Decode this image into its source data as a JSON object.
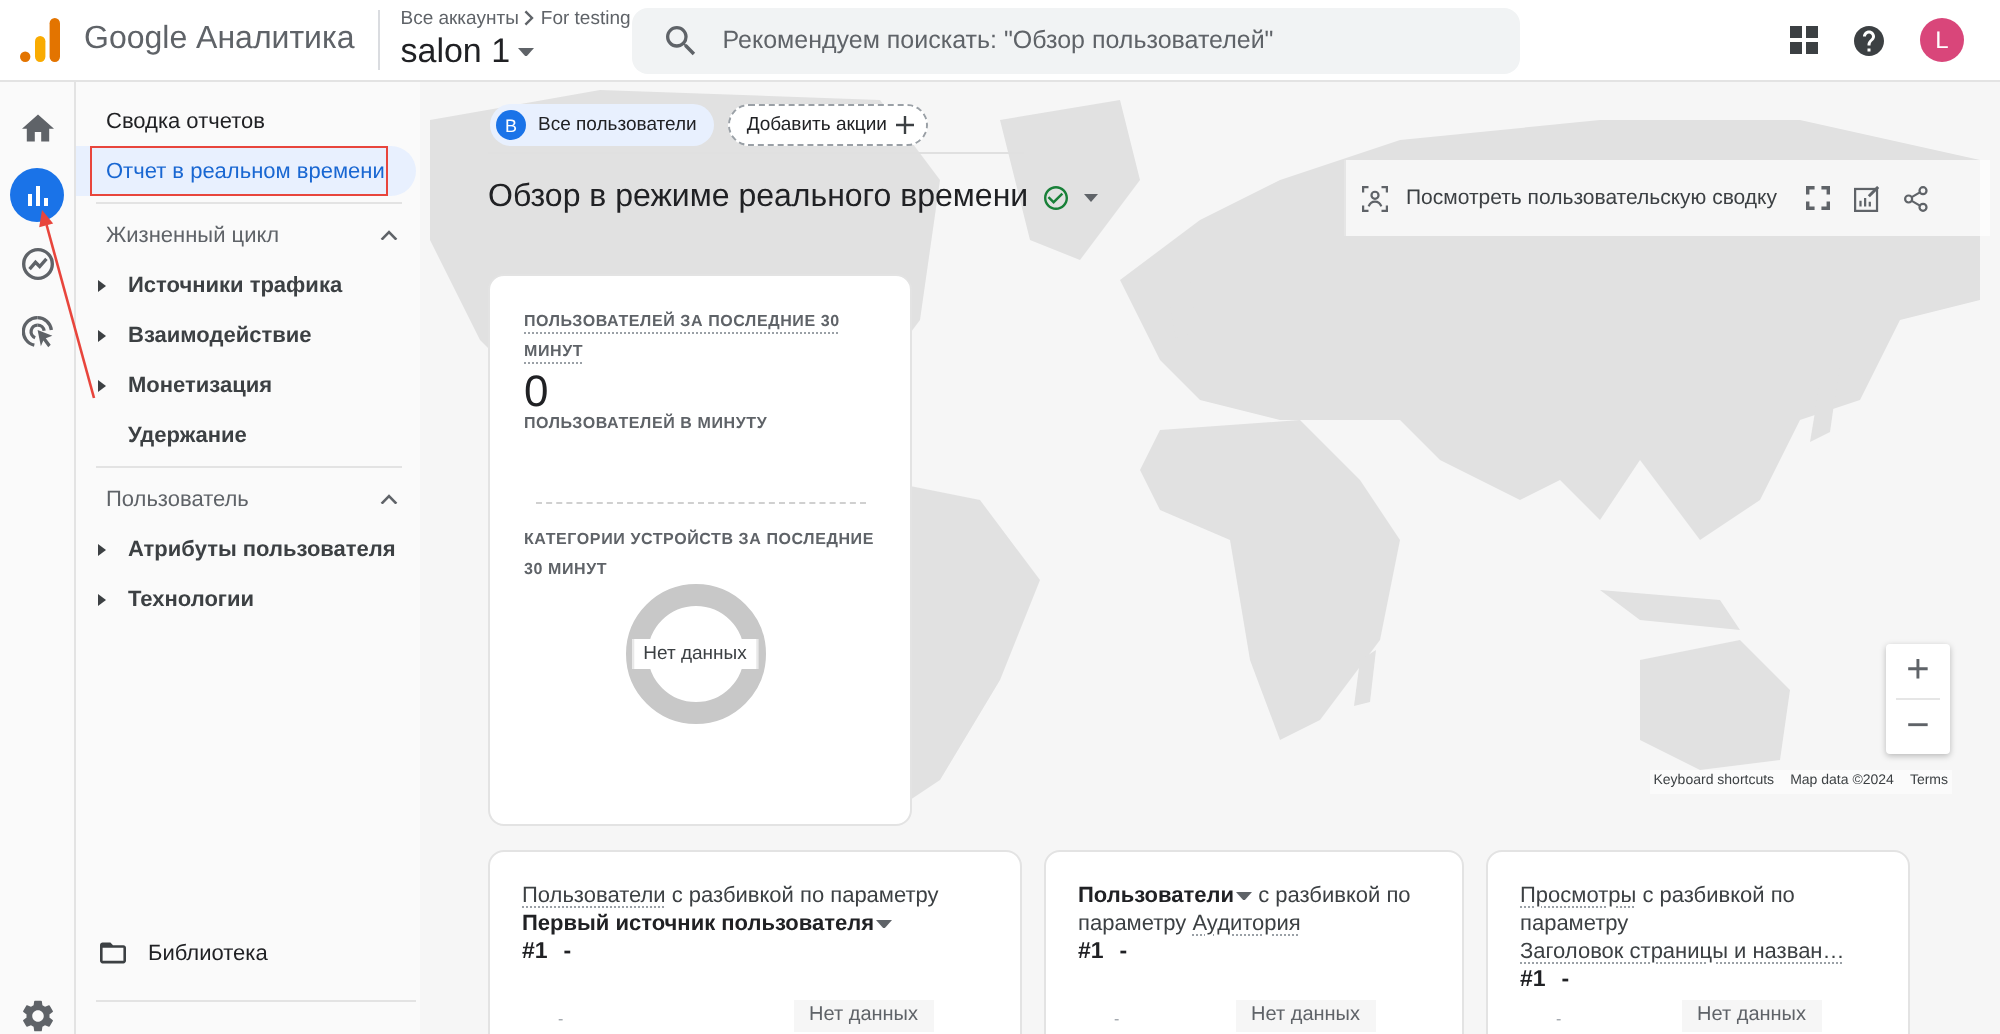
{
  "header": {
    "product": "Google Аналитика",
    "breadcrumb": [
      "Все аккаунты",
      "For testing"
    ],
    "property": "salon 1",
    "search": {
      "placeholder": "Рекомендуем поискать: \"Обзор пользователей\""
    },
    "avatar": "L"
  },
  "rail": [
    {
      "kind": "home",
      "selected": false
    },
    {
      "kind": "reports",
      "selected": true
    },
    {
      "kind": "explore",
      "selected": false
    },
    {
      "kind": "advertising",
      "selected": false
    },
    {
      "kind": "settings",
      "selected": false
    }
  ],
  "nav": {
    "items": [
      {
        "label": "Сводка отчетов",
        "selected": false,
        "annotated": false
      },
      {
        "label": "Отчет в реальном времени",
        "selected": true,
        "annotated": true
      }
    ],
    "sections": [
      {
        "title": "Жизненный цикл",
        "expanded": true,
        "items": [
          {
            "label": "Источники трафика",
            "kind": "group",
            "selected": false
          },
          {
            "label": "Взаимодействие",
            "kind": "group",
            "selected": false
          },
          {
            "label": "Монетизация",
            "kind": "group",
            "selected": false
          },
          {
            "label": "Удержание",
            "kind": "page",
            "selected": false
          }
        ]
      },
      {
        "title": "Пользователь",
        "expanded": true,
        "items": [
          {
            "label": "Атрибуты пользователя",
            "kind": "group",
            "selected": false
          },
          {
            "label": "Технологии",
            "kind": "group",
            "selected": false
          }
        ]
      }
    ],
    "library": "Библиотека"
  },
  "annotations": [
    {
      "kind": "arrow"
    }
  ],
  "filters": {
    "segment": {
      "badge": "В",
      "label": "Все пользователи"
    },
    "add_label": "Добавить акции"
  },
  "title": "Обзор в режиме реального времени",
  "snapshot_label": "Посмотреть пользовательскую сводку",
  "summary": {
    "users_label": "ПОЛЬЗОВАТЕЛЕЙ ЗА ПОСЛЕДНИЕ 30 МИНУТ",
    "value": "0",
    "per_minute_label": "ПОЛЬЗОВАТЕЛЕЙ В МИНУТУ",
    "devices_label": "КАТЕГОРИИ УСТРОЙСТВ ЗА ПОСЛЕДНИЕ 30 МИНУТ",
    "devices_empty": "Нет данных"
  },
  "map": {
    "zoom": [
      "+",
      "−"
    ],
    "attribution": [
      "Keyboard shortcuts",
      "Map data ©2024",
      "Terms"
    ]
  },
  "breakdowns": [
    {
      "metric": {
        "text": "Пользователи",
        "kind": "term"
      },
      "connector": "с разбивкой по параметру",
      "dimension": {
        "text": "Первый источник пользователя",
        "kind": "dropdown"
      },
      "rank": "#1",
      "value": "-",
      "tick": "-",
      "empty": "Нет данных"
    },
    {
      "metric": {
        "text": "Пользователи",
        "kind": "dropdown"
      },
      "connector": "с разбивкой по параметру",
      "dimension": {
        "text": "Аудитория",
        "kind": "term"
      },
      "rank": "#1",
      "value": "-",
      "tick": "-",
      "empty": "Нет данных"
    },
    {
      "metric": {
        "text": "Просмотры",
        "kind": "term"
      },
      "connector": "с разбивкой по параметру",
      "dimension": {
        "text": "Заголовок страницы и назван…",
        "kind": "term"
      },
      "rank": "#1",
      "value": "-",
      "tick": "-",
      "empty": "Нет данных"
    }
  ]
}
